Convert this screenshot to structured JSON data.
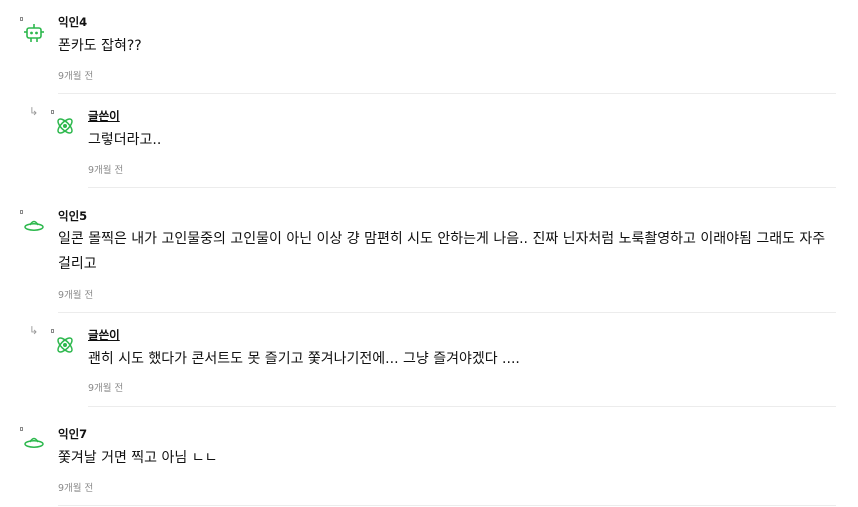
{
  "comments": [
    {
      "name": "익인4",
      "text": "폰카도 잡혀??",
      "time": "9개월 전",
      "icon": "green-robot-icon"
    },
    {
      "name": "글쓴이",
      "text": "그렇더라고..",
      "time": "9개월 전",
      "icon": "green-atom-icon",
      "reply_icon": "reply-arrow-icon"
    },
    {
      "name": "익인5",
      "text": "일콘 몰찍은 내가 고인물중의 고인물이 아닌 이상 걍 맘편히 시도 안하는게 나음.. 진짜 닌자처럼 노룩촬영하고 이래야됨 그래도 자주 걸리고",
      "time": "9개월 전",
      "icon": "green-ufo-icon"
    },
    {
      "name": "글쓴이",
      "text": "괜히 시도 했다가 콘서트도 못 즐기고 쫓겨나기전에... 그냥 즐겨야겠다 ....",
      "time": "9개월 전",
      "icon": "green-atom-icon",
      "reply_icon": "reply-arrow-icon"
    },
    {
      "name": "익인7",
      "text": "쫓겨날 거면 찍고 아님 ㄴㄴ",
      "time": "9개월 전",
      "icon": "green-ufo-icon"
    }
  ],
  "colors": {
    "icon_green": "#2db84d",
    "time_gray": "#8a8a8a",
    "divider": "#ececec"
  }
}
